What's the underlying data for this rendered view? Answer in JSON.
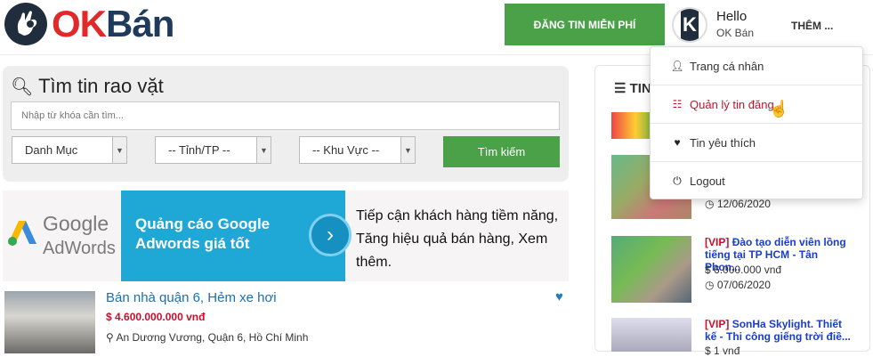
{
  "header": {
    "logo_ok": "OK",
    "logo_ban": "Bán",
    "post_button": "ĐĂNG TIN MIỄN PHÍ",
    "avatar_letter": "K",
    "hello": "Hello",
    "user_name": "OK Bán",
    "more": "THÊM ..."
  },
  "search": {
    "title": "Tìm tin rao vặt",
    "placeholder": "Nhập từ khóa cần tìm...",
    "category": "Danh Mục",
    "province": "-- Tỉnh/TP --",
    "area": "-- Khu Vực --",
    "submit": "Tìm kiếm"
  },
  "banner": {
    "google": "Google",
    "adwords": "AdWords",
    "headline": "Quảng cáo Google Adwords giá tốt",
    "arrow": "›",
    "copy": "Tiếp cận khách hàng tiềm năng, Tăng hiệu quả bán hàng, Xem thêm."
  },
  "listing": {
    "title": "Bán nhà quận 6, Hẻm xe hơi",
    "price": "$ 4.600.000.000 vnđ",
    "location": "An Dương Vương, Quận 6, Hồ Chí Minh"
  },
  "right": {
    "heading": "TIN",
    "items": [
      {
        "date": "12/06/2020"
      },
      {
        "vip": "[VIP]",
        "title": "Đào tạo diễn viên lồng tiếng tại TP HCM - Tân Phon...",
        "price": "6.000.000 vnđ",
        "date": "07/06/2020"
      },
      {
        "vip": "[VIP]",
        "title": "SonHa Skylight. Thiết kế - Thi công giếng trời điề...",
        "price": "1 vnđ"
      }
    ]
  },
  "menu": {
    "items": [
      {
        "label": "Trang cá nhân",
        "icon": "user-icon"
      },
      {
        "label": "Quản lý tin đăng",
        "icon": "list-icon"
      },
      {
        "label": "Tin yêu thích",
        "icon": "heart-icon"
      },
      {
        "label": "Logout",
        "icon": "power-icon"
      }
    ]
  },
  "colors": {
    "green": "#4aa147",
    "red": "#c8102e",
    "blue": "#1fa8d6",
    "link": "#1b6fb0"
  }
}
